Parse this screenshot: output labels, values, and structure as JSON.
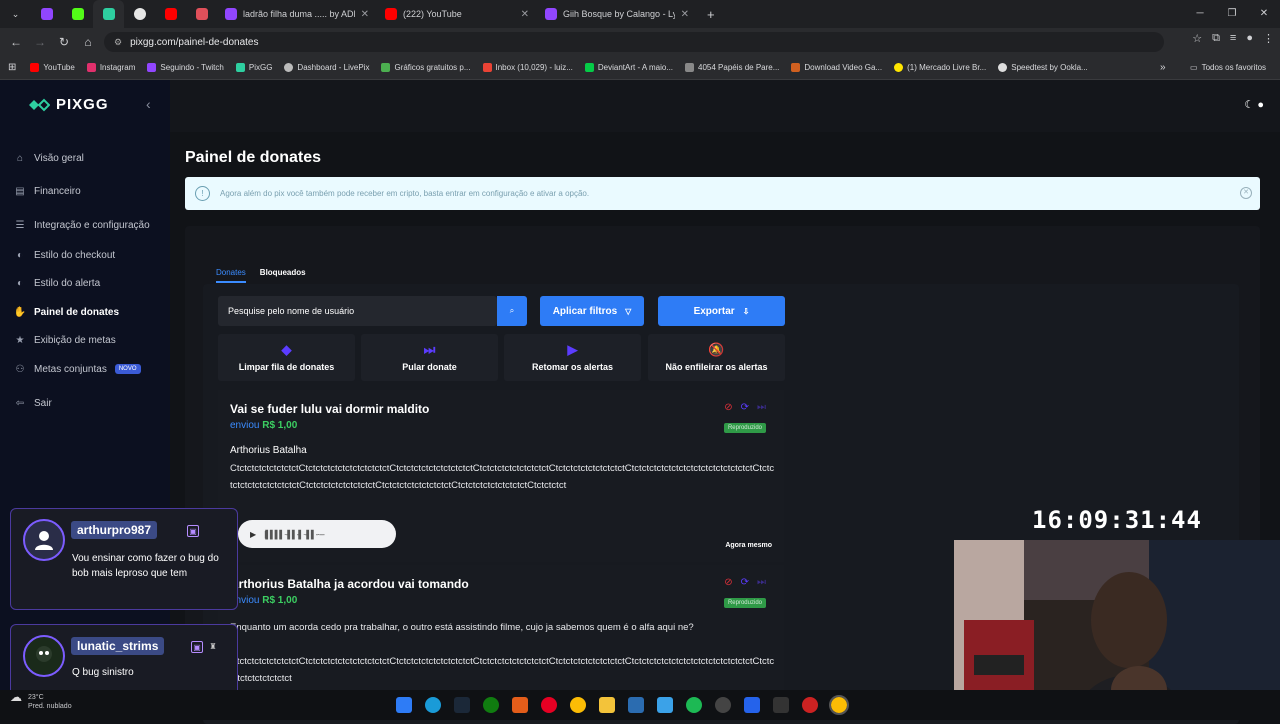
{
  "browser": {
    "tabs": [
      {
        "title": "ladrão filha duma ..... by ADRYA"
      },
      {
        "title": "(222) YouTube"
      },
      {
        "title": "Giih Bosque by Calango - Lyrics"
      }
    ],
    "url": "pixgg.com/painel-de-donates",
    "bookmarks": [
      "YouTube",
      "Instagram",
      "Seguindo - Twitch",
      "PixGG",
      "Dashboard - LivePix",
      "Gráficos gratuitos p...",
      "Inbox (10,029) - luiz...",
      "DeviantArt - A maio...",
      "4054 Papéis de Pare...",
      "Download Video Ga...",
      "(1) Mercado Livre Br...",
      "Speedtest by Ookla..."
    ],
    "all_bookmarks": "Todos os favoritos"
  },
  "sidebar": {
    "logo": "PIXGG",
    "items": [
      {
        "label": "Visão geral"
      },
      {
        "label": "Financeiro"
      },
      {
        "label": "Integração e configuração"
      },
      {
        "label": "Estilo do checkout"
      },
      {
        "label": "Estilo do alerta"
      },
      {
        "label": "Painel de donates"
      },
      {
        "label": "Exibição de metas"
      },
      {
        "label": "Metas conjuntas",
        "badge": "NOVO"
      },
      {
        "label": "Sair"
      }
    ]
  },
  "main": {
    "title": "Painel de donates",
    "notice": "Agora além do pix você também pode receber em cripto, basta entrar em configuração e ativar a opção.",
    "tabs": [
      "Donates",
      "Bloqueados"
    ],
    "search_placeholder": "Pesquise pelo nome de usuário",
    "apply_filters": "Aplicar filtros",
    "export": "Exportar",
    "actions": [
      "Limpar fila de donates",
      "Pular donate",
      "Retomar os alertas",
      "Não enfileirar os alertas"
    ]
  },
  "donations": [
    {
      "title": "Vai se fuder lulu vai dormir maldito",
      "sent": "enviou",
      "amount": "R$ 1,00",
      "status": "Reproduzido",
      "donor": "Arthorius Batalha",
      "message": "CtctctctctctctctctCtctctctctctctctctctctctCtctctctctctctctctctctCtctctctctctctctctctCtctctctctctctctctctCtctctctctctctctctctctctctctctctctCtctctctctctctctctctctctCtctctctctctctctctctCtctctctctctctctctctCtctctctctctctctctctCtctctctct",
      "time_ago": "Agora mesmo"
    },
    {
      "title": "Arthorius Batalha ja acordou vai tomando",
      "sent": "enviou",
      "amount": "R$ 1,00",
      "status": "Reproduzido",
      "message": "Enquanto um acorda cedo pra trabalhar, o outro está assistindo filme, cujo ja sabemos quem é o alfa aqui ne?",
      "message2": "CtctctctctctctctctCtctctctctctctctctctctctCtctctctctctctctctctctCtctctctctctctctctctCtctctctctctctctctctCtctctctctctctctctctctctctctctctctCtctctctctctctctctctct"
    }
  ],
  "overlay": {
    "chat": [
      {
        "user": "arthurpro987",
        "text": "Vou ensinar como fazer o bug do bob mais leproso que tem"
      },
      {
        "user": "lunatic_strims",
        "text": "Q bug sinistro"
      }
    ],
    "clock": "16:09:31:44",
    "weather_temp": "23°C",
    "weather_desc": "Pred. nublado"
  },
  "colors": {
    "accent": "#2e7cf6",
    "sidebar_bg": "#0c1020",
    "success": "#2f9a47",
    "danger": "#e0303a"
  }
}
